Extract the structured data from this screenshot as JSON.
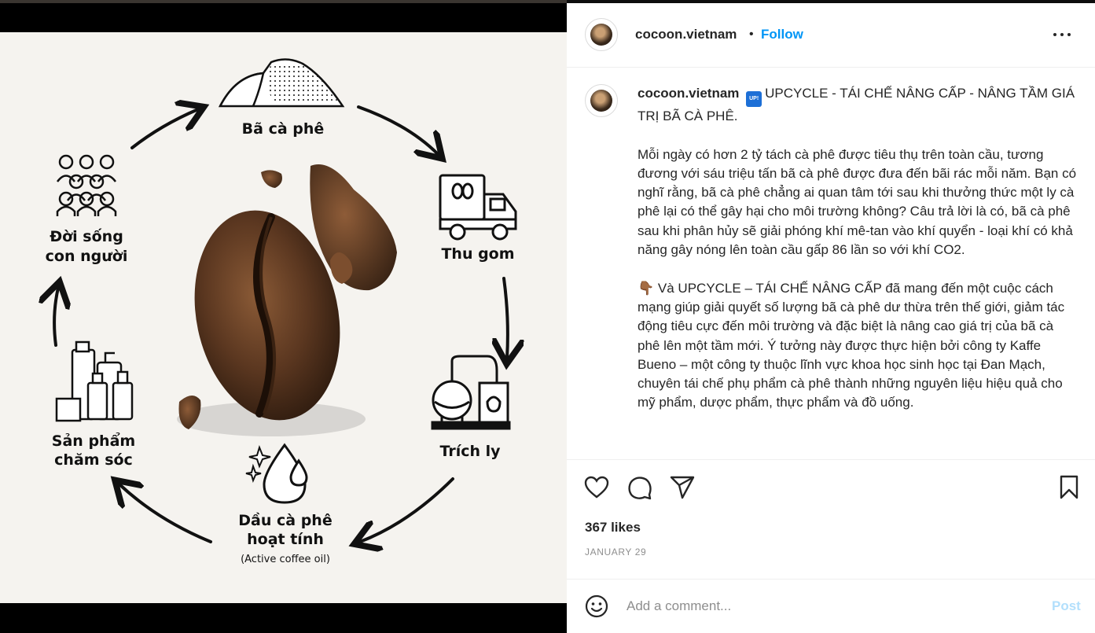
{
  "post": {
    "username": "cocoon.vietnam",
    "separator": "•",
    "follow_label": "Follow"
  },
  "image": {
    "steps": {
      "top": "Bã cà phê",
      "right_top": "Thu gom",
      "right_bottom": "Trích ly",
      "bottom_line1": "Dầu cà phê",
      "bottom_line2": "hoạt tính",
      "bottom_line3": "(Active coffee oil)",
      "left_bottom_line1": "Sản phẩm",
      "left_bottom_line2": "chăm sóc",
      "left_top_line1": "Đời sống",
      "left_top_line2": "con người"
    }
  },
  "caption": {
    "username": "cocoon.vietnam",
    "badge": "UP!",
    "heading": "UPCYCLE - TÁI CHẾ NÂNG CẤP - NÂNG TẦM GIÁ TRỊ BÃ CÀ PHÊ.",
    "para1": "Mỗi ngày có hơn 2 tỷ tách cà phê được tiêu thụ trên toàn cầu, tương đương với sáu triệu tấn bã cà phê được đưa đến bãi rác mỗi năm. Bạn có nghĩ rằng, bã cà phê chẳng ai quan tâm tới sau khi thưởng thức một ly cà phê lại có thể gây hại cho môi trường không? Câu trả lời là có, bã cà phê sau khi phân hủy sẽ giải phóng khí mê-tan vào khí quyển - loại khí có khả năng gây nóng lên toàn cầu gấp 86 lần so với khí CO2.",
    "hand_emoji": "👇🏾",
    "para2": "Và UPCYCLE – TÁI CHẾ NÂNG CẤP đã mang đến một cuộc cách mạng giúp giải quyết số lượng bã cà phê dư thừa trên thế giới, giảm tác động tiêu cực đến môi trường và đặc biệt là nâng cao giá trị của bã cà phê lên một tầm mới. Ý tưởng này được thực hiện bởi công ty Kaffe Bueno – một công ty thuộc lĩnh vực khoa học sinh học tại Đan Mạch, chuyên tái chế phụ phẩm cà phê thành những nguyên liệu hiệu quả cho mỹ phẩm, dược phẩm, thực phẩm và đồ uống."
  },
  "stats": {
    "likes": "367 likes",
    "date": "JANUARY 29"
  },
  "comment": {
    "placeholder": "Add a comment...",
    "post_label": "Post"
  },
  "colors": {
    "accent": "#0095f6",
    "post_disabled": "#b2dffc",
    "text": "#262626",
    "muted": "#8e8e8e",
    "image_bg": "#f5f3ef"
  },
  "icons": [
    "heart-icon",
    "comment-icon",
    "share-icon",
    "bookmark-icon",
    "emoji-icon",
    "more-icon"
  ]
}
